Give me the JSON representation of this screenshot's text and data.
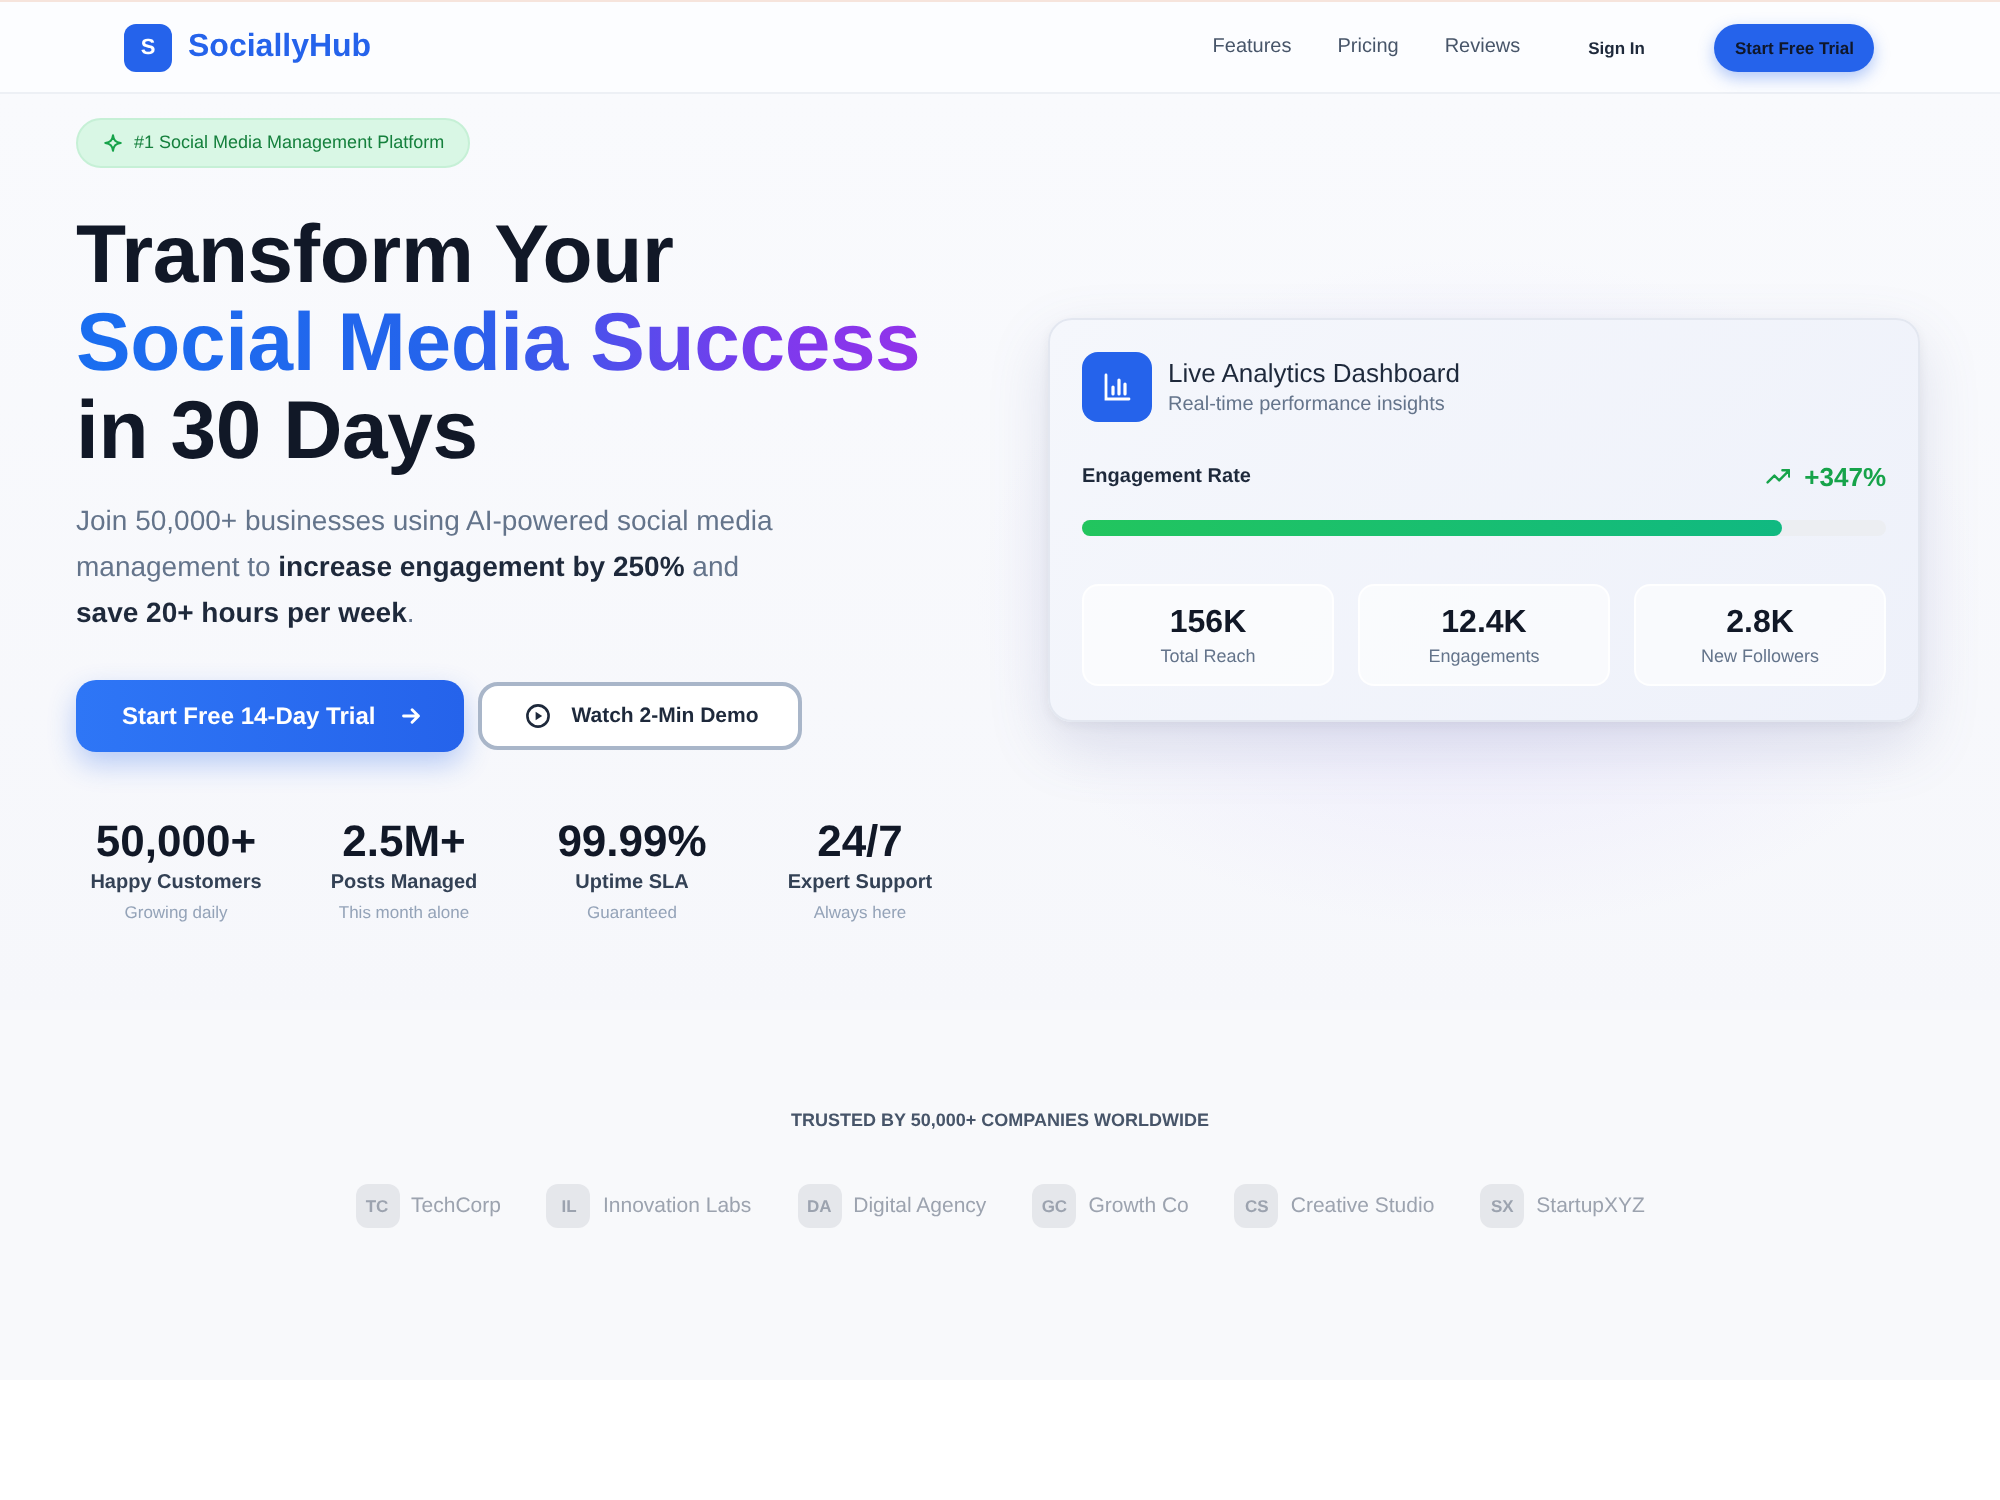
{
  "header": {
    "logo": {
      "mark": "S",
      "name": "SociallyHub"
    },
    "nav": [
      {
        "label": "Features"
      },
      {
        "label": "Pricing"
      },
      {
        "label": "Reviews"
      }
    ],
    "sign_in": "Sign In",
    "cta": "Start Free Trial"
  },
  "hero": {
    "badge": "#1 Social Media Management Platform",
    "headline": [
      {
        "text": "Transform Your",
        "kind": "plain"
      },
      {
        "text": "Social Media Success",
        "kind": "gradient"
      },
      {
        "text": "in 30 Days",
        "kind": "plain"
      }
    ],
    "description": "Join 50,000+ businesses using AI-powered social media management to **increase engagement by 250%** and **save 20+ hours per week**.",
    "actions": [
      {
        "kind": "primary",
        "label": "Start Free 14-Day Trial"
      },
      {
        "kind": "secondary",
        "label": "Watch 2-Min Demo"
      }
    ],
    "stats": [
      {
        "value": "50,000+",
        "label": "Happy Customers",
        "note": "Growing daily"
      },
      {
        "value": "2.5M+",
        "label": "Posts Managed",
        "note": "This month alone"
      },
      {
        "value": "99.99%",
        "label": "Uptime SLA",
        "note": "Guaranteed"
      },
      {
        "value": "24/7",
        "label": "Expert Support",
        "note": "Always here"
      }
    ]
  },
  "dashboard": {
    "title": "Live Analytics Dashboard",
    "subtitle": "Real-time performance insights",
    "metric": {
      "label": "Engagement Rate",
      "change": "+347%",
      "level": 0.87
    },
    "stats": [
      {
        "value": "156K",
        "label": "Total Reach"
      },
      {
        "value": "12.4K",
        "label": "Engagements"
      },
      {
        "value": "2.8K",
        "label": "New Followers"
      }
    ]
  },
  "trusted": {
    "heading": "TRUSTED BY 50,000+ COMPANIES WORLDWIDE",
    "companies": [
      {
        "initials": "TC",
        "name": "TechCorp"
      },
      {
        "initials": "IL",
        "name": "Innovation Labs"
      },
      {
        "initials": "DA",
        "name": "Digital Agency"
      },
      {
        "initials": "GC",
        "name": "Growth Co"
      },
      {
        "initials": "CS",
        "name": "Creative Studio"
      },
      {
        "initials": "SX",
        "name": "StartupXYZ"
      }
    ]
  }
}
